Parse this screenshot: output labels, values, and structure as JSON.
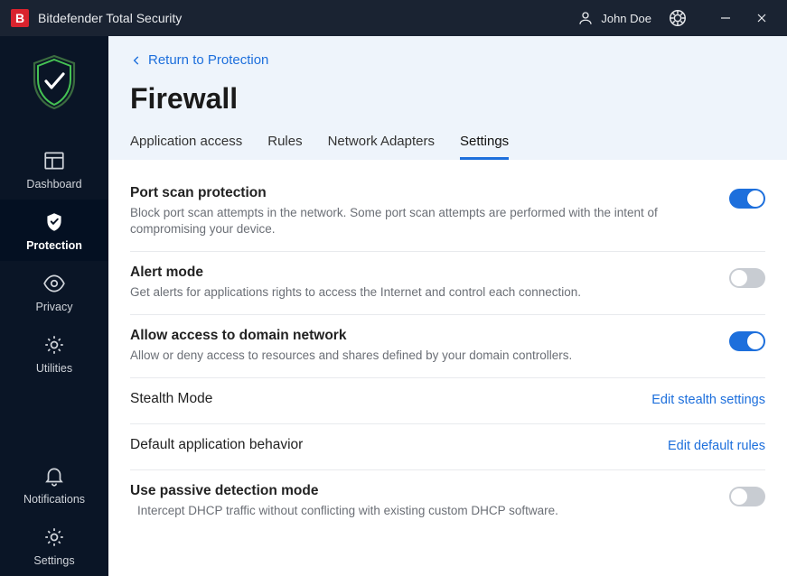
{
  "titlebar": {
    "app_name": "Bitdefender Total Security",
    "user_name": "John Doe"
  },
  "sidebar": {
    "items": [
      {
        "label": "Dashboard"
      },
      {
        "label": "Protection"
      },
      {
        "label": "Privacy"
      },
      {
        "label": "Utilities"
      },
      {
        "label": "Notifications"
      },
      {
        "label": "Settings"
      }
    ]
  },
  "header": {
    "back_label": "Return to Protection",
    "page_title": "Firewall",
    "tabs": [
      {
        "label": "Application access"
      },
      {
        "label": "Rules"
      },
      {
        "label": "Network Adapters"
      },
      {
        "label": "Settings"
      }
    ]
  },
  "settings": [
    {
      "title": "Port scan protection",
      "desc": "Block port scan attempts in the network. Some port scan attempts are performed with the intent of compromising your device.",
      "control": "toggle",
      "on": true
    },
    {
      "title": "Alert mode",
      "desc": "Get alerts for applications rights to access the Internet and control each connection.",
      "control": "toggle",
      "on": false
    },
    {
      "title": "Allow access to domain network",
      "desc": "Allow or deny access to resources and shares defined by your domain controllers.",
      "control": "toggle",
      "on": true
    },
    {
      "title": "Stealth Mode",
      "control": "link",
      "action_label": "Edit stealth settings"
    },
    {
      "title": "Default application behavior",
      "control": "link",
      "action_label": "Edit default rules"
    },
    {
      "title": "Use passive detection mode",
      "desc": "Intercept DHCP traffic without conflicting with existing custom DHCP software.",
      "control": "toggle",
      "on": false,
      "indent": true
    }
  ]
}
